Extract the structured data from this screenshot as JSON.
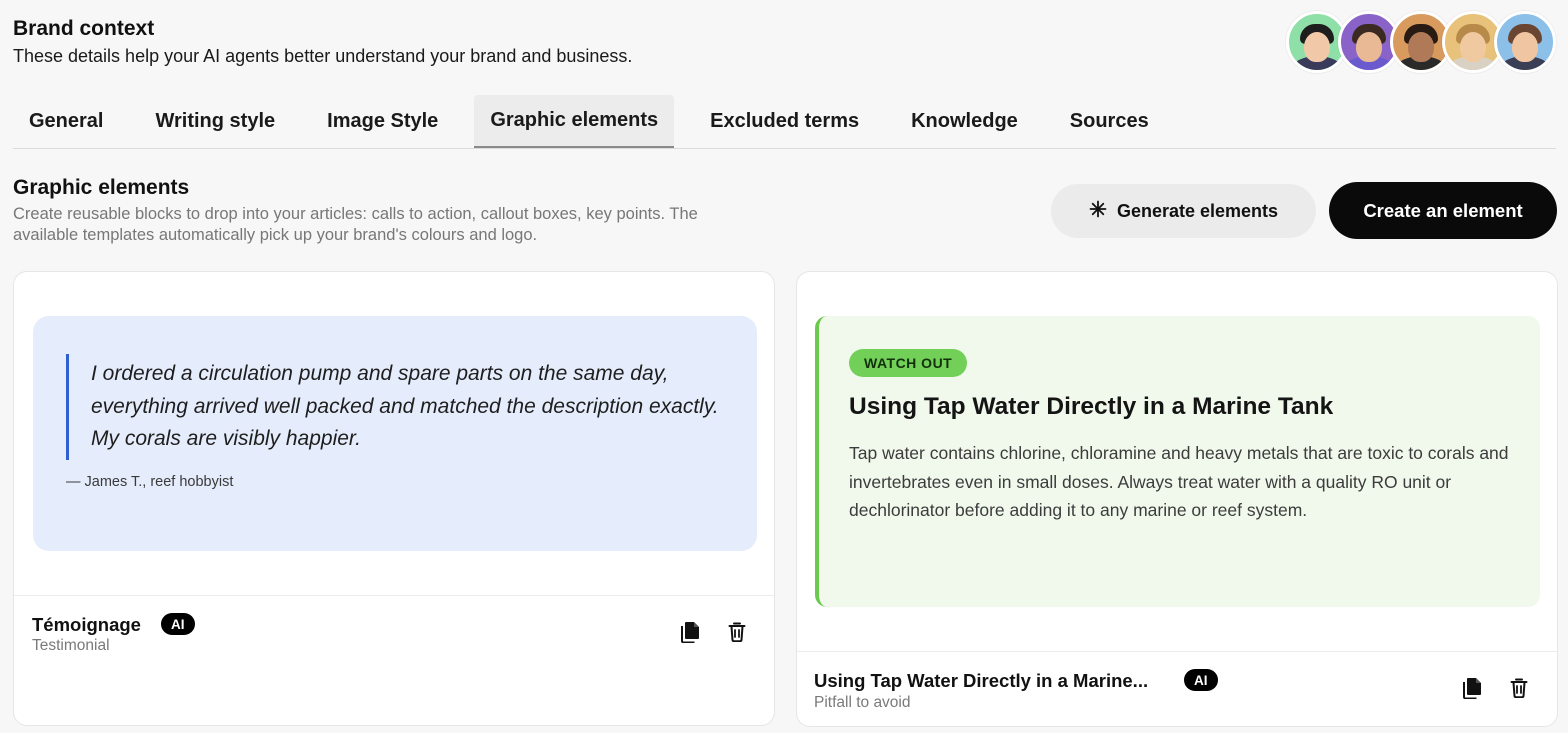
{
  "header": {
    "title": "Brand context",
    "subtitle": "These details help your AI agents better understand your brand and business."
  },
  "avatars": [
    {
      "name": "avatar-1",
      "bg": "#8fe0a8",
      "skin": "#f2c9a8",
      "hair": "#1e1e1e",
      "shirt": "#3a3a5a"
    },
    {
      "name": "avatar-2",
      "bg": "#8a63c9",
      "skin": "#e9b996",
      "hair": "#3a2a22",
      "shirt": "#6a5acd"
    },
    {
      "name": "avatar-3",
      "bg": "#d99a5e",
      "skin": "#b07a58",
      "hair": "#2a1a14",
      "shirt": "#2a2a2a"
    },
    {
      "name": "avatar-4",
      "bg": "#e8c27a",
      "skin": "#f0c9a0",
      "hair": "#b88a4a",
      "shirt": "#d9d2c4"
    },
    {
      "name": "avatar-5",
      "bg": "#8cc0e8",
      "skin": "#f0c6a2",
      "hair": "#6a4632",
      "shirt": "#3a3f55"
    }
  ],
  "tabs": [
    {
      "label": "General",
      "active": false
    },
    {
      "label": "Writing style",
      "active": false
    },
    {
      "label": "Image Style",
      "active": false
    },
    {
      "label": "Graphic elements",
      "active": true
    },
    {
      "label": "Excluded terms",
      "active": false
    },
    {
      "label": "Knowledge",
      "active": false
    },
    {
      "label": "Sources",
      "active": false
    }
  ],
  "section": {
    "title": "Graphic elements",
    "description": "Create reusable blocks to drop into your articles: calls to action, callout boxes, key points. The available templates automatically pick up your brand's colours and logo.",
    "generate_label": "Generate elements",
    "create_label": "Create an element"
  },
  "cards": [
    {
      "quote": "I ordered a circulation pump and spare parts on the same day, everything arrived well packed and matched the description exactly. My corals are visibly happier.",
      "author": "— James T., reef hobbyist",
      "title": "Témoignage",
      "badge": "AI",
      "subtitle": "Testimonial"
    },
    {
      "tag": "WATCH OUT",
      "heading": "Using Tap Water Directly in a Marine Tank",
      "body": "Tap water contains chlorine, chloramine and heavy metals that are toxic to corals and invertebrates even in small doses. Always treat water with a quality RO unit or dechlorinator before adding it to any marine or reef system.",
      "title": "Using Tap Water Directly in a Marine...",
      "badge": "AI",
      "subtitle": "Pitfall to avoid"
    }
  ],
  "colors": {
    "accent_blue": "#2f5fd0",
    "quote_bg": "#e5ecfb",
    "callout_bg": "#f0f9ec",
    "callout_green": "#6cc94f"
  }
}
